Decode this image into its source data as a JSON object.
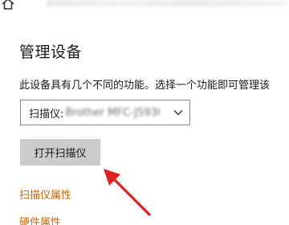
{
  "page": {
    "title": "管理设备",
    "description": "此设备具有几个不同的功能。选择一个功能即可管理该"
  },
  "device_select": {
    "prefix": "扫描仪: ",
    "value": "Brother MFC-J5930"
  },
  "actions": {
    "open_scanner_label": "打开扫描仪"
  },
  "links": {
    "scanner_properties": "扫描仪属性",
    "hardware_properties": "硬件属性"
  },
  "colors": {
    "link": "#c06700",
    "button_bg": "#cccccc",
    "annotation_arrow": "#e02020"
  },
  "icons": {
    "home": "home-icon",
    "chevron": "chevron-down-icon",
    "annotation": "red-arrow-annotation"
  }
}
